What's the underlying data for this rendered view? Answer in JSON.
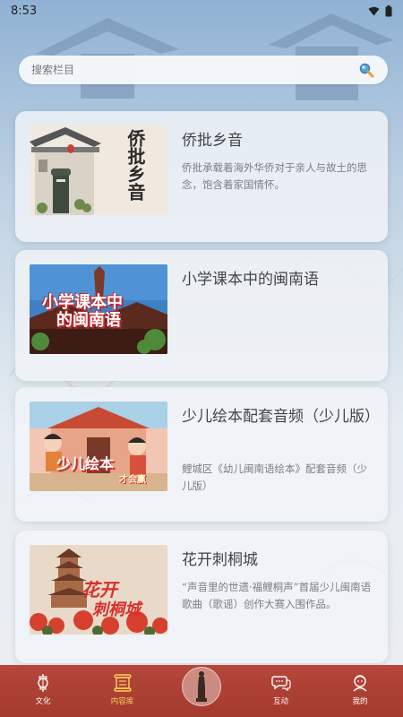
{
  "status_bar": {
    "time": "8:53"
  },
  "search": {
    "placeholder": "搜索栏目"
  },
  "cards": [
    {
      "title": "侨批乡音",
      "description": "侨批承载着海外华侨对于亲人与故土的思念，饱含着家国情怀。",
      "thumb_text": "侨批乡音"
    },
    {
      "title": "小学课本中的闽南语",
      "description": "",
      "thumb_text_line1": "小学课本中",
      "thumb_text_line2": "的闽南语"
    },
    {
      "title": "少儿绘本配套音频（少儿版）",
      "description": "鲤城区《幼儿闽南语绘本》配套音频（少儿版）",
      "thumb_text_line1": "少儿绘本",
      "thumb_text_line2": "才会赢"
    },
    {
      "title": "花开刺桐城",
      "description": "“声音里的世遗·福鲤桐声”首届少儿闽南语歌曲（歌谣）创作大赛入围作品。",
      "thumb_text_line1": "花开",
      "thumb_text_line2": "刺桐城"
    }
  ],
  "nav": {
    "items": [
      {
        "label": "文化",
        "icon": "lantern-icon"
      },
      {
        "label": "内容库",
        "icon": "scroll-icon",
        "active": true
      },
      {
        "label": "",
        "icon": "statue-icon"
      },
      {
        "label": "互动",
        "icon": "chat-icon"
      },
      {
        "label": "我的",
        "icon": "profile-icon"
      }
    ],
    "active_color": "#f6d458",
    "bar_color": "#b5463a"
  }
}
